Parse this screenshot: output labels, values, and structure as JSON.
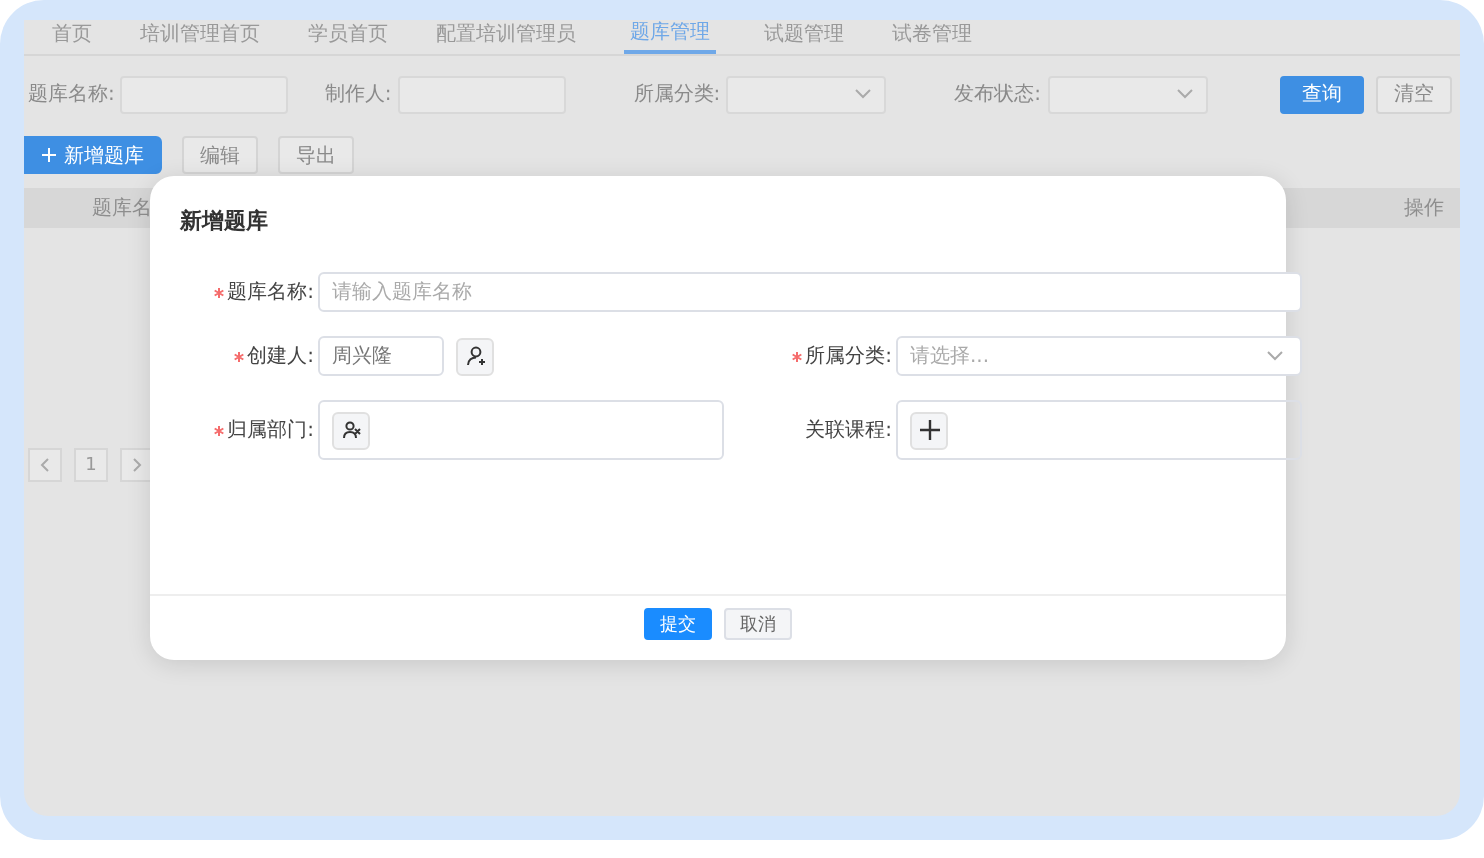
{
  "tabs": [
    {
      "label": "首页",
      "selected": false
    },
    {
      "label": "培训管理首页",
      "selected": false
    },
    {
      "label": "学员首页",
      "selected": false
    },
    {
      "label": "配置培训管理员",
      "selected": false
    },
    {
      "label": "题库管理",
      "selected": true
    },
    {
      "label": "试题管理",
      "selected": false
    },
    {
      "label": "试卷管理",
      "selected": false
    }
  ],
  "filters": [
    {
      "label": "题库名称:",
      "kind": "input"
    },
    {
      "label": "制作人:",
      "kind": "input"
    },
    {
      "label": "所属分类:",
      "kind": "select"
    },
    {
      "label": "发布状态:",
      "kind": "select"
    }
  ],
  "filter_buttons": [
    {
      "label": "查询",
      "kind": "primary"
    },
    {
      "label": "清空",
      "kind": "default"
    }
  ],
  "toolbar": [
    {
      "label": "新增题库",
      "kind": "primary"
    },
    {
      "label": "编辑",
      "kind": "default"
    },
    {
      "label": "导出",
      "kind": "default"
    }
  ],
  "table": {
    "columns": [
      "题库名",
      "操作"
    ]
  },
  "pagination": {
    "current": "1"
  },
  "dialog": {
    "title": "新增题库",
    "fields": [
      {
        "label": "题库名称:",
        "required": true,
        "kind": "text",
        "placeholder": "请输入题库名称"
      },
      {
        "label": "创建人:",
        "required": true,
        "kind": "person",
        "value": "周兴隆"
      },
      {
        "label": "所属分类:",
        "required": true,
        "kind": "select",
        "placeholder": "请选择..."
      },
      {
        "label": "归属部门:",
        "required": true,
        "kind": "department"
      },
      {
        "label": "关联课程:",
        "required": false,
        "kind": "course"
      }
    ],
    "buttons": [
      {
        "label": "提交",
        "kind": "primary"
      },
      {
        "label": "取消",
        "kind": "default"
      }
    ]
  }
}
